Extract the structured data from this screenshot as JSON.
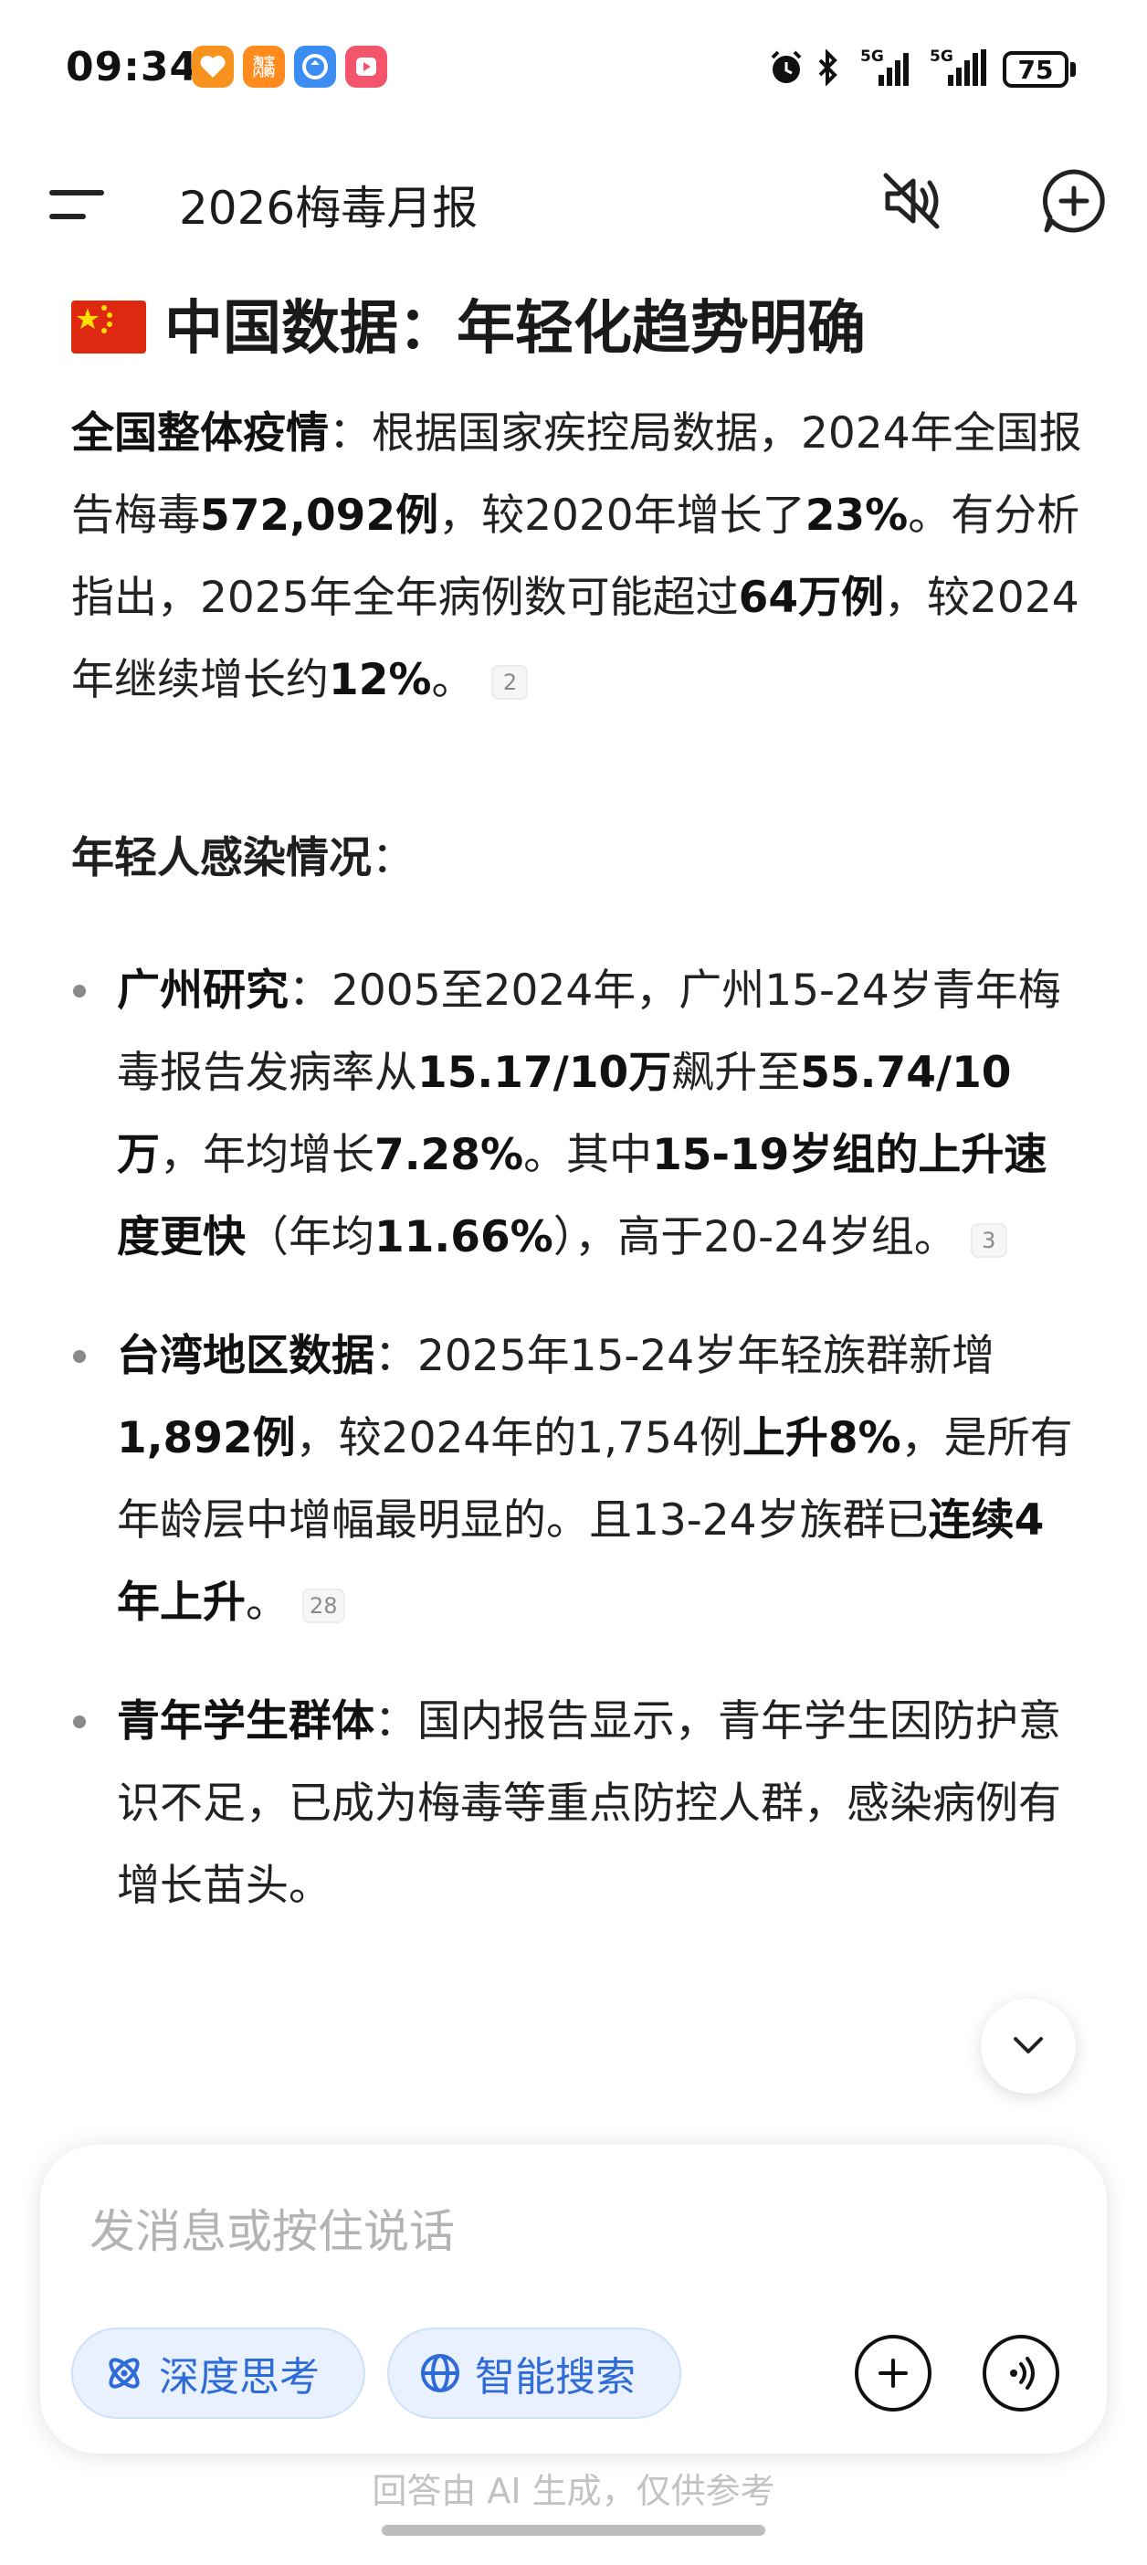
{
  "status_bar": {
    "time": "09:34",
    "app_icons": [
      {
        "name": "orange-app-icon",
        "color": "#f7921e",
        "label": ""
      },
      {
        "name": "taobao-flash-icon",
        "color": "#ff8a1e",
        "label": "淘宝\n闪购"
      },
      {
        "name": "blue-sync-app-icon",
        "color": "#3b8df2",
        "label": ""
      },
      {
        "name": "video-app-icon",
        "color": "#f2556c",
        "label": ""
      }
    ],
    "signal_1_label": "5G",
    "signal_2_label": "5G",
    "battery": "75"
  },
  "header": {
    "title": "2026梅毒月报",
    "icons": [
      "menu-icon",
      "speaker-muted-icon",
      "new-chat-plus-icon"
    ]
  },
  "content": {
    "section_title": "中国数据：年轻化趋势明确",
    "flag_icon": "china-flag-icon",
    "para1": {
      "bold1": "全国整体疫情",
      "t1": "：根据国家疾控局数据，2024年全国报告梅毒",
      "bold2": "572,092例",
      "t2": "，较2020年增长了",
      "bold3": "23%",
      "t3": "。有分析指出，2025年全年病例数可能超过",
      "bold4": "64万例",
      "t4": "，较2024年继续增长约",
      "bold5": "12%",
      "t5": "。",
      "cite": "2"
    },
    "subhead": {
      "bold": "年轻人感染情况",
      "t": "："
    },
    "bullets": [
      {
        "bold1": "广州研究",
        "t1": "：2005至2024年，广州15-24岁青年梅毒报告发病率从",
        "bold2": "15.17/10万",
        "t2": "飙升至",
        "bold3": "55.74/10万",
        "t3": "，年均增长",
        "bold4": "7.28%",
        "t4": "。其中",
        "bold5": "15-19岁组的上升速度更快",
        "t5": "（年均",
        "bold6": "11.66%",
        "t6": "），高于20-24岁组。",
        "cite": "3"
      },
      {
        "bold1": "台湾地区数据",
        "t1": "：2025年15-24岁年轻族群新增",
        "bold2": "1,892例",
        "t2": "，较2024年的1,754例",
        "bold3": "上升8%",
        "t3": "，是所有年龄层中增幅最明显的。且13-24岁族群已",
        "bold4": "连续4年上升",
        "t4": "。",
        "cite": "28"
      },
      {
        "bold1": "青年学生群体",
        "t1": "：国内报告显示，青年学生因防护意识不足，已成为梅毒等重点防控人群，感染病例有增长苗头。"
      }
    ]
  },
  "composer": {
    "placeholder": "发消息或按住说话",
    "chip_deep_think": "深度思考",
    "chip_search": "智能搜索",
    "accent_color": "#2f6bd6"
  },
  "disclaimer": "回答由 AI 生成，仅供参考"
}
